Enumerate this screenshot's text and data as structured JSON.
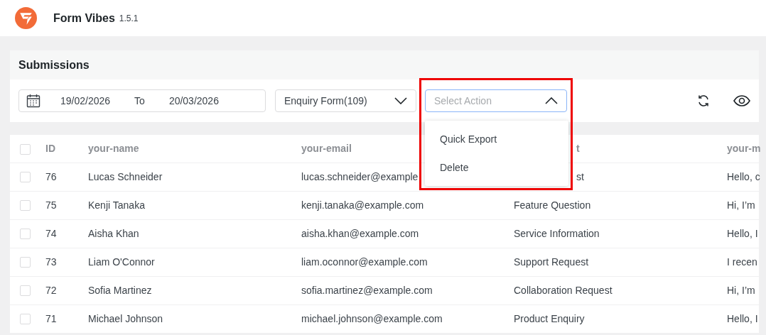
{
  "app": {
    "name": "Form Vibes",
    "version": "1.5.1"
  },
  "panel": {
    "title": "Submissions"
  },
  "toolbar": {
    "date_from": "19/02/2026",
    "date_separator": "To",
    "date_to": "20/03/2026",
    "form_select": {
      "value": "Enquiry Form(109)",
      "expanded": false
    },
    "action_select": {
      "placeholder": "Select Action",
      "expanded": true,
      "highlighted": true,
      "options": [
        "Quick Export",
        "Delete"
      ]
    }
  },
  "table": {
    "columns": [
      {
        "label": "ID"
      },
      {
        "label": "your-name"
      },
      {
        "label": "your-email"
      },
      {
        "label": "t",
        "partly_hidden": true
      },
      {
        "label": "your-m"
      }
    ],
    "rows": [
      {
        "checked": false,
        "cells": [
          {
            "text": "76"
          },
          {
            "text": "Lucas Schneider"
          },
          {
            "text": "lucas.schneider@example"
          },
          {
            "text": "st",
            "partly_hidden": true
          },
          {
            "text": "Hello, c"
          }
        ]
      },
      {
        "checked": false,
        "cells": [
          {
            "text": "75"
          },
          {
            "text": "Kenji Tanaka"
          },
          {
            "text": "kenji.tanaka@example.com"
          },
          {
            "text": "Feature Question"
          },
          {
            "text": "Hi, I’m"
          }
        ]
      },
      {
        "checked": false,
        "cells": [
          {
            "text": "74"
          },
          {
            "text": "Aisha Khan"
          },
          {
            "text": "aisha.khan@example.com"
          },
          {
            "text": "Service Information"
          },
          {
            "text": "Hello, I"
          }
        ]
      },
      {
        "checked": false,
        "cells": [
          {
            "text": "73"
          },
          {
            "text": "Liam O'Connor"
          },
          {
            "text": "liam.oconnor@example.com"
          },
          {
            "text": "Support Request"
          },
          {
            "text": "I recen"
          }
        ]
      },
      {
        "checked": false,
        "cells": [
          {
            "text": "72"
          },
          {
            "text": "Sofia Martinez"
          },
          {
            "text": "sofia.martinez@example.com"
          },
          {
            "text": "Collaboration Request"
          },
          {
            "text": "Hi, I’m"
          }
        ]
      },
      {
        "checked": false,
        "cells": [
          {
            "text": "71"
          },
          {
            "text": "Michael Johnson"
          },
          {
            "text": "michael.johnson@example.com"
          },
          {
            "text": "Product Enquiry"
          },
          {
            "text": "Hello, I"
          }
        ]
      }
    ],
    "all_checked": false
  }
}
